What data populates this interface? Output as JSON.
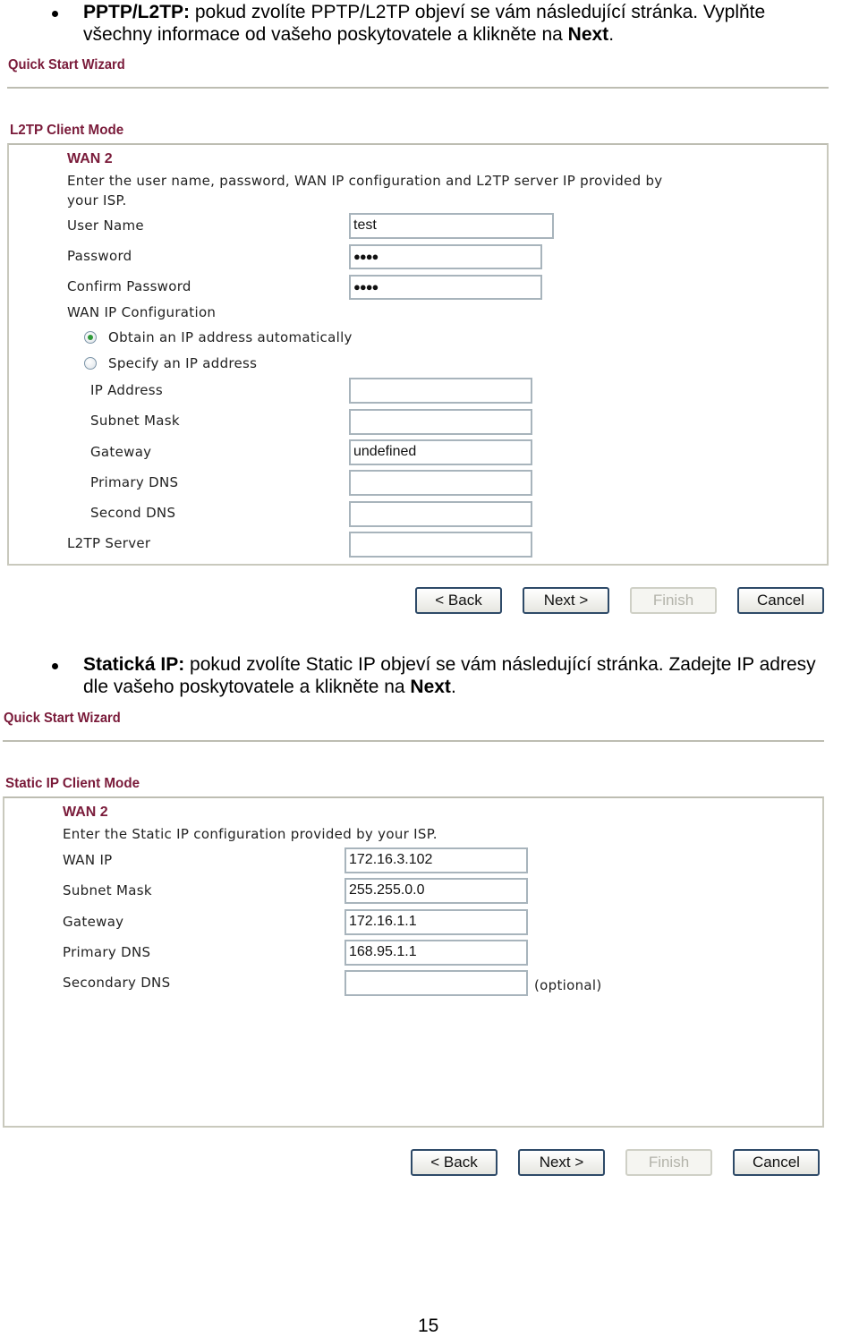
{
  "section1": {
    "bullet_bold": "PPTP/L2TP:",
    "bullet_text_line1": " pokud zvolíte PPTP/L2TP objeví se vám následující stránka. Vyplňte",
    "bullet_text_line2_a": "všechny informace od vašeho poskytovatele a klikněte na ",
    "bullet_text_line2_bold": "Next",
    "bullet_text_line2_end": ".",
    "wizard_title": "Quick Start Wizard",
    "mode_title": "L2TP Client Mode",
    "wan_title": "WAN 2",
    "description_line1": "Enter the user name, password, WAN IP configuration and L2TP server IP provided by",
    "description_line2": "your ISP.",
    "fields": {
      "user_name": {
        "label": "User Name",
        "value": "test"
      },
      "password": {
        "label": "Password",
        "value": "●●●●"
      },
      "confirm_password": {
        "label": "Confirm Password",
        "value": "●●●●"
      },
      "wan_ip_config_label": "WAN IP Configuration",
      "radio_obtain": {
        "label": "Obtain an IP address automatically",
        "checked": true
      },
      "radio_specify": {
        "label": "Specify an IP address",
        "checked": false
      },
      "ip_address": {
        "label": "IP Address",
        "value": ""
      },
      "subnet_mask": {
        "label": "Subnet Mask",
        "value": ""
      },
      "gateway": {
        "label": "Gateway",
        "value": "undefined"
      },
      "primary_dns": {
        "label": "Primary DNS",
        "value": ""
      },
      "second_dns": {
        "label": "Second DNS",
        "value": ""
      },
      "l2tp_server": {
        "label": "L2TP Server",
        "value": ""
      }
    },
    "buttons": {
      "back": "< Back",
      "next": "Next >",
      "finish": "Finish",
      "cancel": "Cancel"
    }
  },
  "section2": {
    "bullet_bold": "Statická IP:",
    "bullet_text_line1": " pokud zvolíte Static IP objeví se vám následující stránka. Zadejte IP adresy",
    "bullet_text_line2_a": "dle vašeho poskytovatele a klikněte na ",
    "bullet_text_line2_bold": "Next",
    "bullet_text_line2_end": ".",
    "wizard_title": "Quick Start Wizard",
    "mode_title": "Static IP Client Mode",
    "wan_title": "WAN 2",
    "description": "Enter the Static IP configuration provided by your ISP.",
    "fields": {
      "wan_ip": {
        "label": "WAN IP",
        "value": "172.16.3.102"
      },
      "subnet_mask": {
        "label": "Subnet Mask",
        "value": "255.255.0.0"
      },
      "gateway": {
        "label": "Gateway",
        "value": "172.16.1.1"
      },
      "primary_dns": {
        "label": "Primary DNS",
        "value": "168.95.1.1"
      },
      "secondary_dns": {
        "label": "Secondary DNS",
        "value": "",
        "hint": "(optional)"
      }
    },
    "buttons": {
      "back": "< Back",
      "next": "Next >",
      "finish": "Finish",
      "cancel": "Cancel"
    }
  },
  "page_number": "15"
}
